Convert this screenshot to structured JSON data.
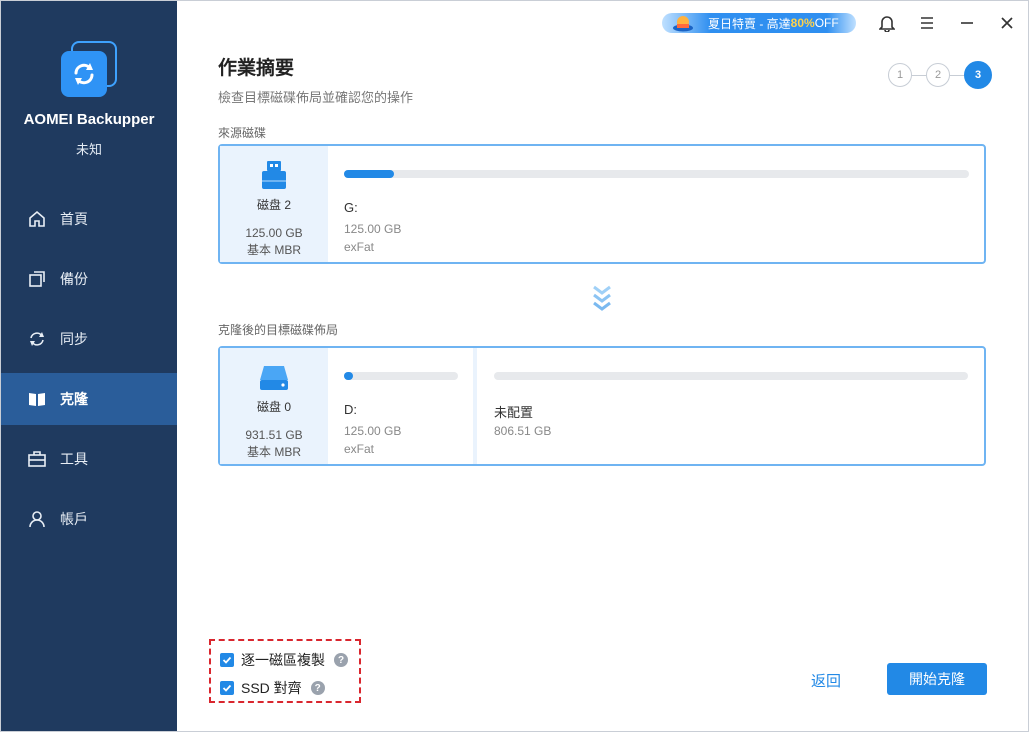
{
  "app": {
    "name": "AOMEI Backupper",
    "edition": "未知"
  },
  "sidebar": {
    "items": [
      {
        "label": "首頁",
        "icon": "home-icon"
      },
      {
        "label": "備份",
        "icon": "backup-icon"
      },
      {
        "label": "同步",
        "icon": "sync-icon"
      },
      {
        "label": "克隆",
        "icon": "clone-icon",
        "active": true
      },
      {
        "label": "工具",
        "icon": "toolbox-icon"
      },
      {
        "label": "帳戶",
        "icon": "user-icon"
      }
    ]
  },
  "topbar": {
    "promo_prefix": "夏日特賣 - 高達",
    "promo_highlight": "80%",
    "promo_suffix": "OFF"
  },
  "header": {
    "title": "作業摘要",
    "subtitle": "檢查目標磁碟佈局並確認您的操作"
  },
  "steps": [
    "1",
    "2",
    "3"
  ],
  "source": {
    "label": "來源磁碟",
    "disk": {
      "name": "磁盘 2",
      "size": "125.00 GB",
      "type": "基本 MBR"
    },
    "partitions": [
      {
        "letter": "G:",
        "size": "125.00 GB",
        "fs": "exFat",
        "used_fraction": 0.08
      }
    ]
  },
  "target": {
    "label": "克隆後的目標磁碟佈局",
    "disk": {
      "name": "磁盘 0",
      "size": "931.51 GB",
      "type": "基本 MBR"
    },
    "partitions": [
      {
        "letter": "D:",
        "size": "125.00 GB",
        "fs": "exFat",
        "used_fraction": 0.08
      },
      {
        "letter": "未配置",
        "size": "806.51 GB",
        "fs": "",
        "used_fraction": 0
      }
    ]
  },
  "options": {
    "sector_by_sector": "逐一磁區複製",
    "ssd_align": "SSD 對齊",
    "help_glyph": "?"
  },
  "buttons": {
    "back": "返回",
    "start": "開始克隆"
  },
  "colors": {
    "sidebar_bg": "#1f3a5f",
    "sidebar_active": "#2a5d9a",
    "accent": "#2289e6",
    "highlight_border": "#d9262e"
  }
}
